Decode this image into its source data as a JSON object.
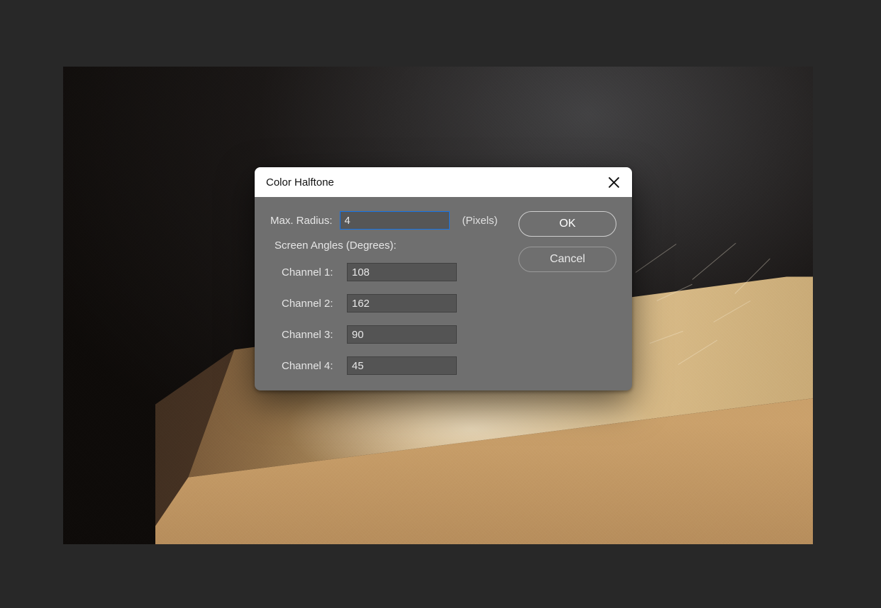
{
  "dialog": {
    "title": "Color Halftone",
    "max_radius_label": "Max. Radius:",
    "max_radius_value": "4",
    "unit_label": "(Pixels)",
    "screen_angles_label": "Screen Angles (Degrees):",
    "channels": [
      {
        "label": "Channel 1:",
        "value": "108"
      },
      {
        "label": "Channel 2:",
        "value": "162"
      },
      {
        "label": "Channel 3:",
        "value": "90"
      },
      {
        "label": "Channel 4:",
        "value": "45"
      }
    ],
    "ok_label": "OK",
    "cancel_label": "Cancel"
  }
}
